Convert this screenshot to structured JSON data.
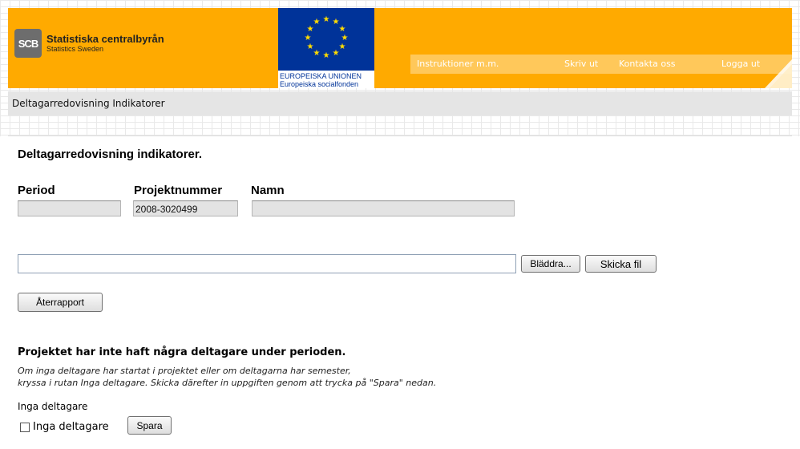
{
  "logo": {
    "mark": "SCB",
    "name": "Statistiska centralbyrån",
    "sub": "Statistics Sweden"
  },
  "eu": {
    "line1": "EUROPEISKA UNIONEN",
    "line2": "Europeiska socialfonden"
  },
  "nav": {
    "instructions": "Instruktioner m.m.",
    "print": "Skriv ut",
    "contact": "Kontakta oss",
    "logout": "Logga ut"
  },
  "subbar": {
    "title": "Deltagarredovisning Indikatorer"
  },
  "main": {
    "heading": "Deltagarredovisning indikatorer.",
    "labels": {
      "period": "Period",
      "project": "Projektnummer",
      "name": "Namn"
    },
    "values": {
      "period": "",
      "project": "2008-3020499",
      "name": ""
    },
    "browse_label": "Bläddra...",
    "send_label": "Skicka fil",
    "report_label": "Återrapport",
    "no_participants_heading": "Projektet har inte haft några deltagare under perioden.",
    "note_line1": "Om inga deltagare har startat i projektet eller om deltagarna har semester,",
    "note_line2": "kryssa i rutan Inga deltagare. Skicka därefter in uppgiften genom att trycka på \"Spara\" nedan.",
    "inga_label": "Inga deltagare",
    "checkbox_label": "Inga deltagare",
    "checkbox_checked": false,
    "save_label": "Spara"
  },
  "colors": {
    "header": "#ffaa00",
    "nav_bar": "#ffc85a",
    "eu_blue": "#003399",
    "subbar": "#e5e5e5"
  }
}
